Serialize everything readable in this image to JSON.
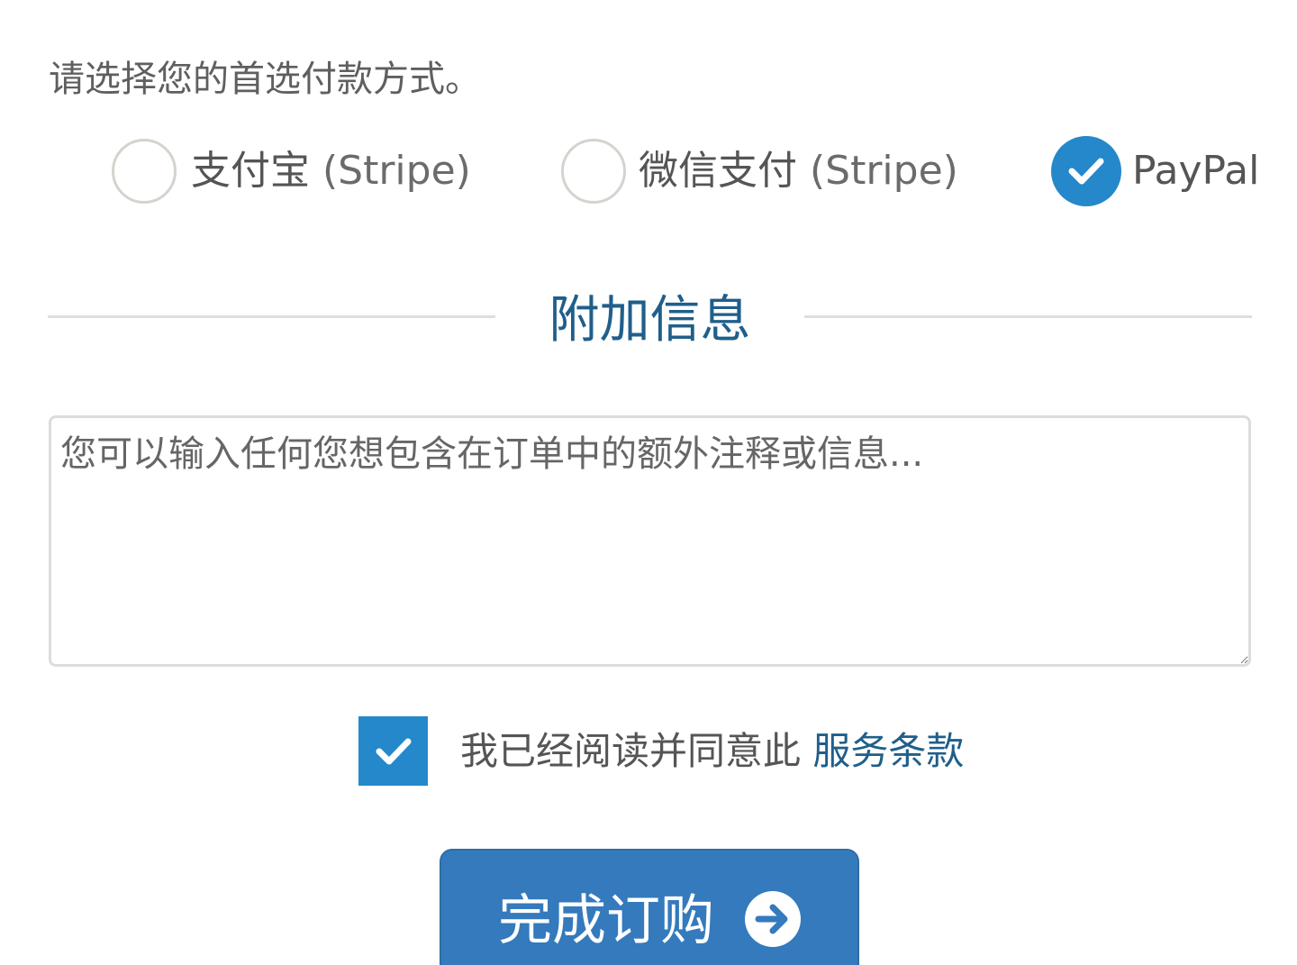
{
  "payment": {
    "prompt": "请选择您的首选付款方式。",
    "options": [
      {
        "label": "支付宝",
        "sub": " (Stripe)",
        "selected": false,
        "icon": "radio-unchecked-icon"
      },
      {
        "label": "微信支付",
        "sub": " (Stripe)",
        "selected": false,
        "icon": "radio-unchecked-icon"
      },
      {
        "label": "PayPal",
        "sub": "",
        "selected": true,
        "icon": "check-icon"
      }
    ]
  },
  "additional": {
    "title": "附加信息",
    "notes_value": "",
    "notes_placeholder": "您可以输入任何您想包含在订单中的额外注释或信息..."
  },
  "terms": {
    "checked": true,
    "text": "我已经阅读并同意此 ",
    "link_label": "服务条款"
  },
  "submit": {
    "label": "完成订购",
    "icon": "arrow-right-circle-icon"
  },
  "colors": {
    "accent": "#2488cb",
    "title": "#1f5f8b",
    "button": "#347abd",
    "text": "#555555",
    "border": "#dcdcdc"
  }
}
